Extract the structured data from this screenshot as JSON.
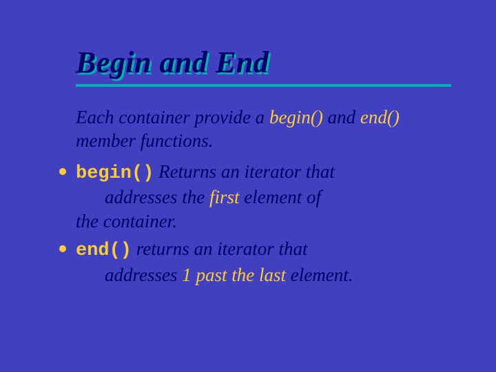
{
  "title": "Begin and End",
  "intro": {
    "pre": "Each container provide a ",
    "hl1": "begin()",
    "mid": " and ",
    "hl2": "end()",
    "post": " member functions."
  },
  "b1": {
    "code": "begin()",
    "t1": " Returns an iterator that",
    "t2_a": "addresses the ",
    "t2_hl": "first",
    "t2_b": " element of",
    "t3": "the container."
  },
  "b2": {
    "code": "end()",
    "t1": " returns an iterator that",
    "t2_a": "addresses ",
    "t2_hl": "1 past the last",
    "t2_b": " element."
  }
}
